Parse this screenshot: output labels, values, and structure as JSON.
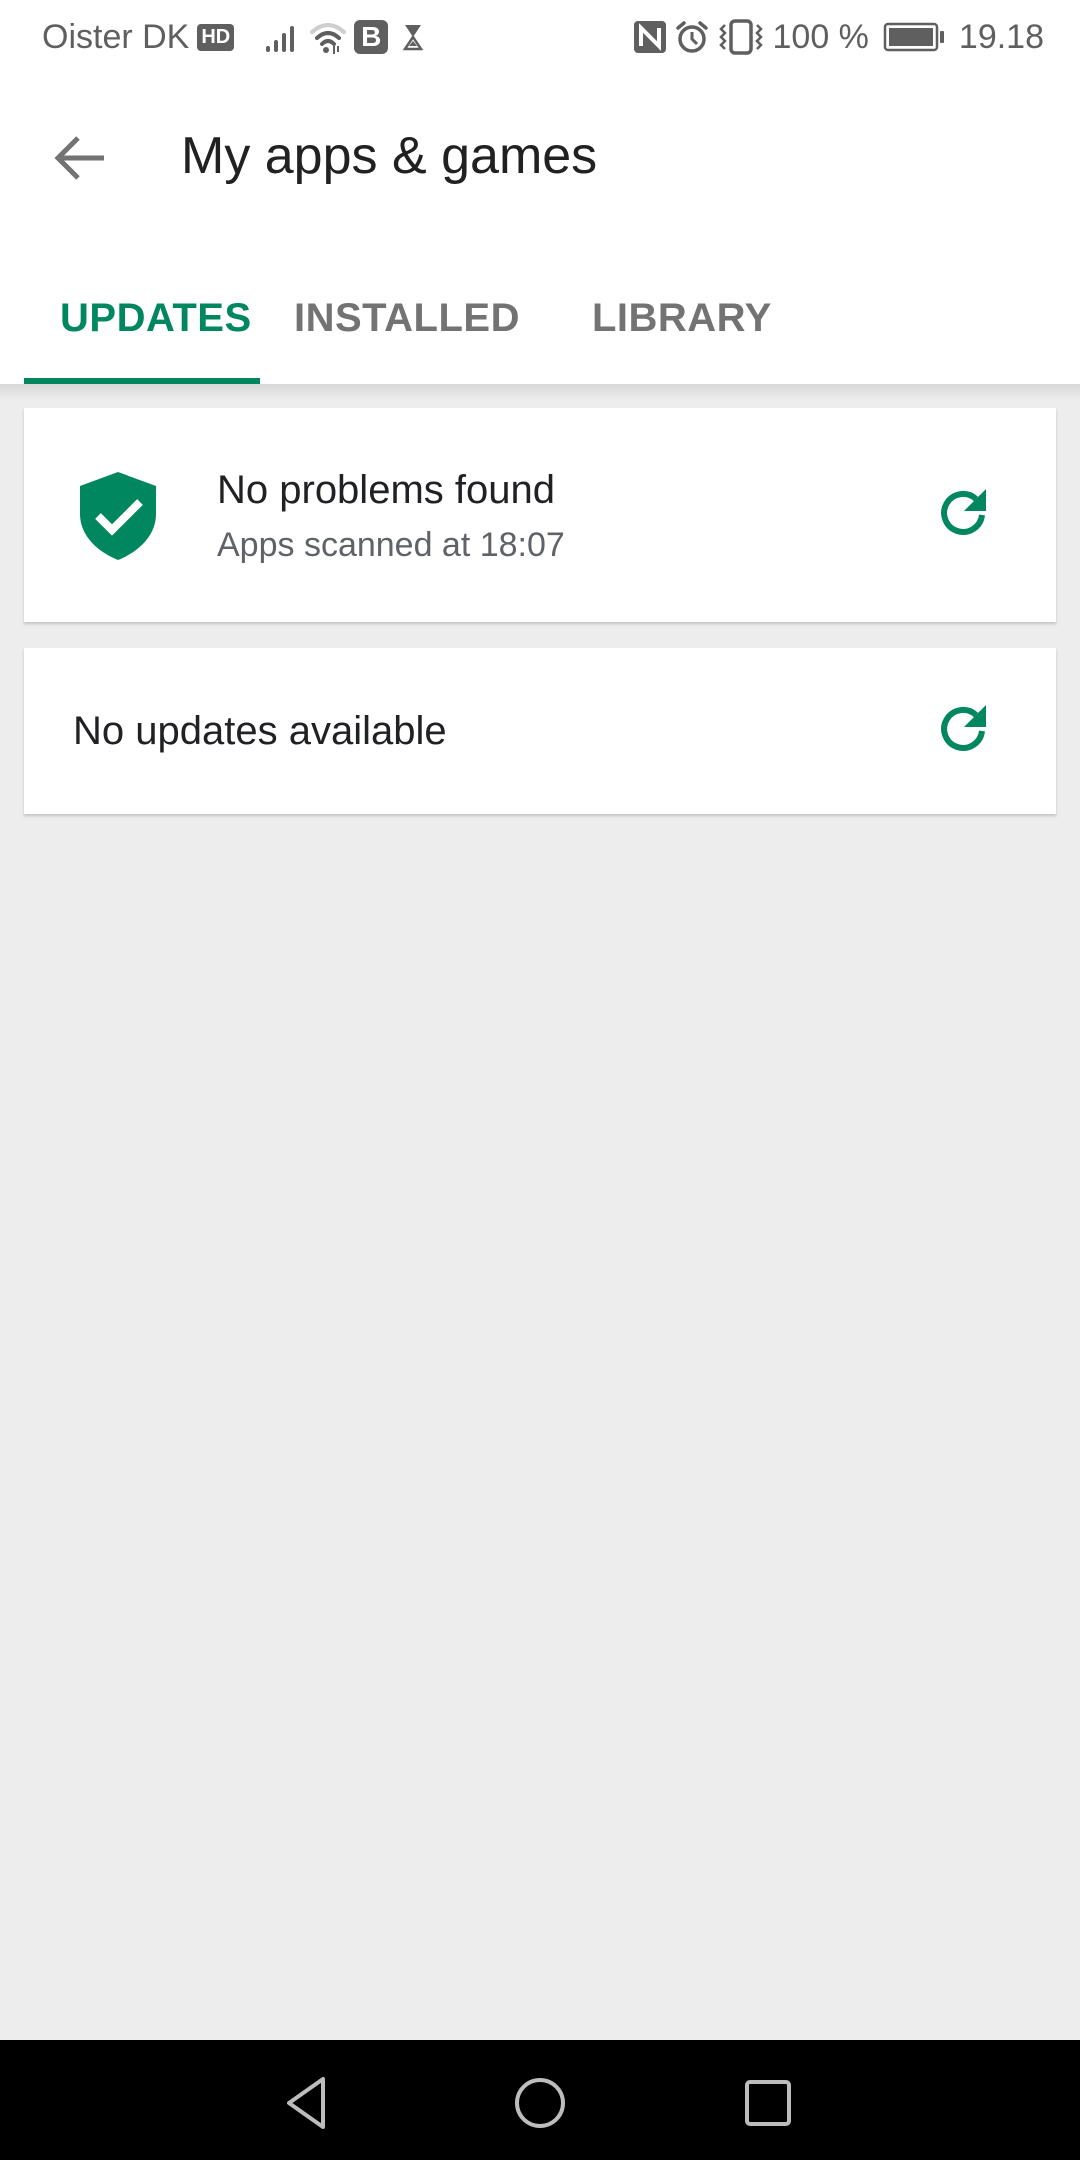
{
  "status_bar": {
    "carrier": "Oister DK",
    "hd_badge": "HD",
    "b_badge": "B",
    "battery_percent": "100 %",
    "time": "19.18",
    "icons": [
      "signal-icon",
      "wifi-icon",
      "hourglass-icon",
      "nfc-icon",
      "alarm-icon",
      "vibrate-icon",
      "battery-icon"
    ]
  },
  "app_bar": {
    "title": "My apps & games",
    "back_icon": "arrow-back-icon"
  },
  "tabs": [
    {
      "label": "UPDATES",
      "active": true
    },
    {
      "label": "INSTALLED",
      "active": false
    },
    {
      "label": "LIBRARY",
      "active": false
    }
  ],
  "security_card": {
    "icon": "shield-check-icon",
    "title": "No problems found",
    "subtitle": "Apps scanned at 18:07",
    "action_icon": "refresh-icon"
  },
  "updates_card": {
    "text": "No updates available",
    "action_icon": "refresh-icon"
  },
  "colors": {
    "accent": "#01875f",
    "tab_inactive": "#737373",
    "background": "#ededed"
  },
  "nav_bar": {
    "buttons": [
      "back",
      "home",
      "recents"
    ]
  }
}
